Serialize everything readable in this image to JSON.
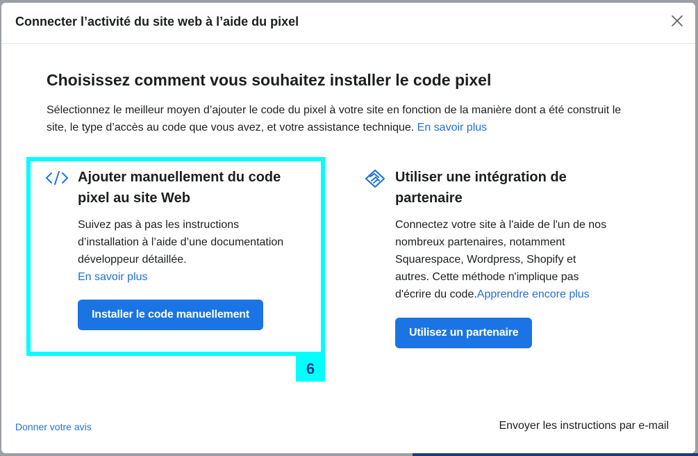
{
  "dialog": {
    "title": "Connecter l’activité du site web à l’aide du pixel",
    "close_icon": "close-icon"
  },
  "section": {
    "title": "Choisissez comment vous souhaitez installer le code pixel",
    "description": "Sélectionnez le meilleur moyen d’ajouter le code du pixel à votre site en fonction de la manière dont a été construit le site, le type d’accès au code que vous avez, et votre assistance technique.",
    "learn_more": "En savoir plus"
  },
  "options": {
    "manual": {
      "icon": "code-icon",
      "title": "Ajouter manuellement du code pixel au site Web",
      "description": "Suivez pas à pas les instructions d’installation à l’aide d’une documentation développeur détaillée.",
      "learn_more": "En savoir plus",
      "button": "Installer le code manuellement",
      "badge": "6"
    },
    "partner": {
      "icon": "handshake-icon",
      "title": "Utiliser une intégration de partenaire",
      "description": "Connectez votre site à l'aide de l'un de nos nombreux partenaires, notamment Squarespace, Wordpress, Shopify et autres. Cette méthode n'implique pas d'écrire du code.",
      "learn_more": "Apprendre encore plus",
      "button": "Utilisez un partenaire"
    }
  },
  "footer": {
    "feedback": "Donner votre avis",
    "email_instructions": "Envoyer les instructions par e-mail"
  },
  "colors": {
    "accent": "#1b74e4",
    "link": "#216fdb",
    "highlight": "#00ffff"
  }
}
